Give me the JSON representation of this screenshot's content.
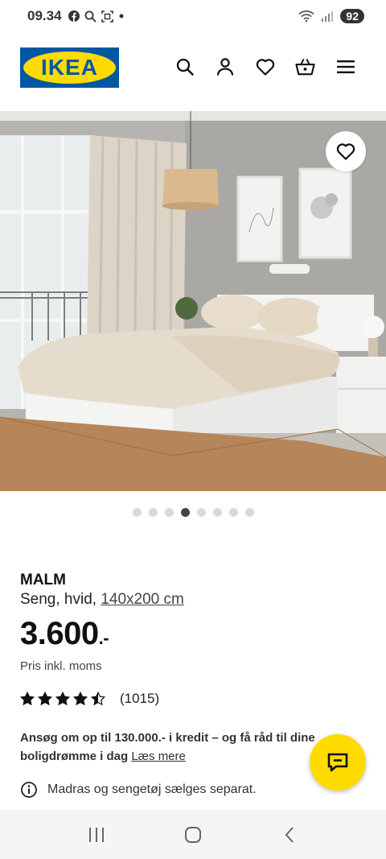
{
  "status": {
    "time": "09.34",
    "notif_icons": [
      "facebook-icon",
      "search-icon",
      "screenshot-icon",
      "dot-icon"
    ],
    "battery": "92"
  },
  "header": {
    "logo_text": "IKEA",
    "icons": [
      "search-icon",
      "account-icon",
      "favourites-icon",
      "basket-icon",
      "menu-icon"
    ]
  },
  "gallery": {
    "image_count": 8,
    "active_index": 3
  },
  "product": {
    "name": "MALM",
    "description": "Seng, hvid, ",
    "size": "140x200 cm",
    "price": "3.600",
    "price_suffix": ".-",
    "vat_note": "Pris inkl. moms",
    "rating_value": 4.5,
    "review_count": "(1015)"
  },
  "credit": {
    "text": "Ansøg om op til 130.000.- i kredit – og få råd til dine boligdrømme i dag ",
    "link": "Læs mere"
  },
  "notice": {
    "text": "Madras og sengetøj sælges separat."
  },
  "colors": {
    "ikea_blue": "#0058a3",
    "ikea_yellow": "#ffdb00"
  }
}
